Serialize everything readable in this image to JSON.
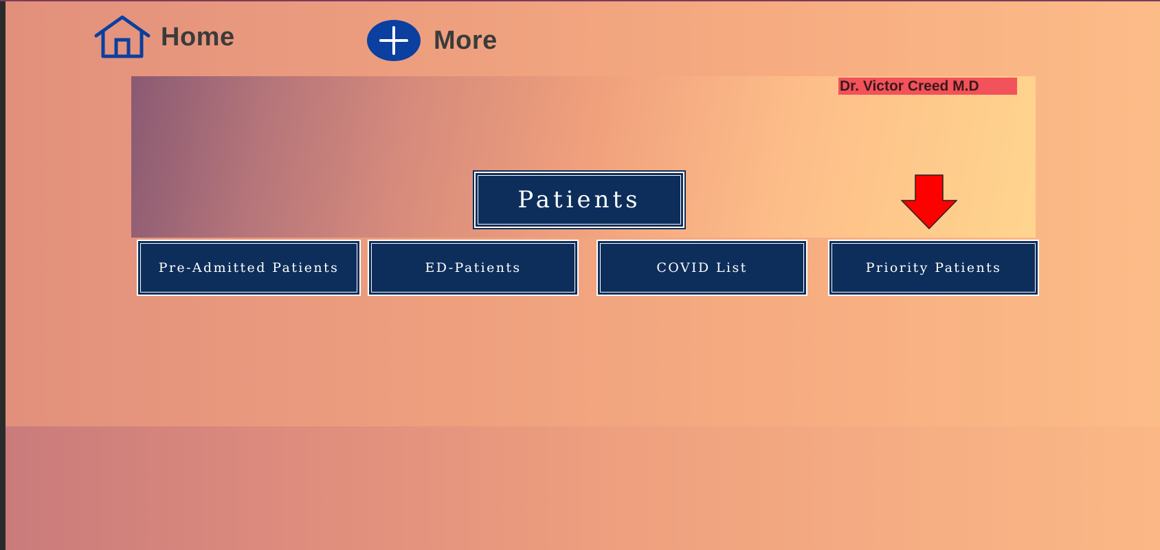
{
  "nav": {
    "home_label": "Home",
    "home_icon": "home-icon",
    "more_label": "More",
    "more_icon": "plus-circle-icon"
  },
  "banner": {
    "doctor_name": "Dr. Victor Creed M.D",
    "title": "Patients",
    "indicator_icon": "down-arrow-icon"
  },
  "buttons": [
    {
      "label": "Pre-Admitted Patients"
    },
    {
      "label": "ED-Patients"
    },
    {
      "label": "COVID List"
    },
    {
      "label": "Priority Patients"
    }
  ],
  "colors": {
    "button_fill": "#0d2e5a",
    "button_text": "#ffffff",
    "nav_icon_blue": "#0b3fa0",
    "doctor_tag_bg": "#f2525a",
    "arrow": "#ff0000"
  }
}
